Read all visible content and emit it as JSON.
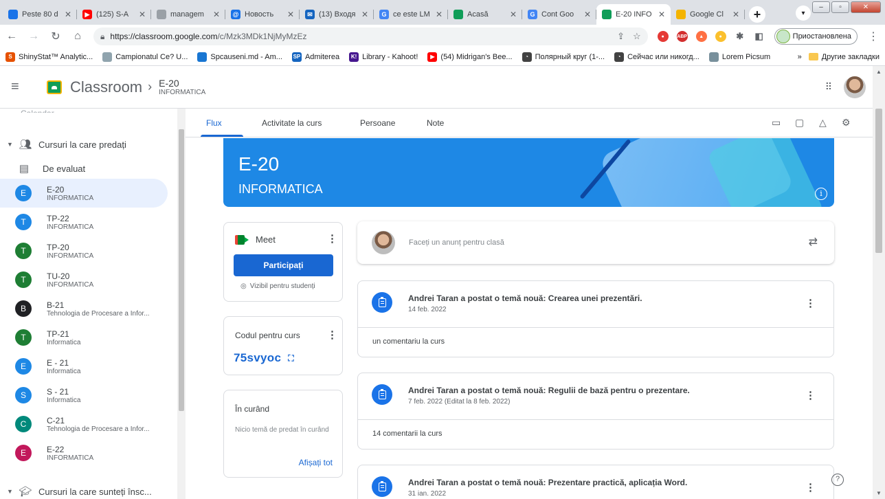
{
  "browser": {
    "tabs": [
      {
        "label": "Peste 80 d",
        "fav_color": "#1a73e8",
        "fav_char": "◉"
      },
      {
        "label": "(125) S-A",
        "fav_color": "#ff0000",
        "fav_char": "▶"
      },
      {
        "label": "managem",
        "fav_color": "#9aa0a6",
        "fav_char": "●"
      },
      {
        "label": "Новость",
        "fav_color": "#1a73e8",
        "fav_char": "@"
      },
      {
        "label": "(13) Входя",
        "fav_color": "#1565c0",
        "fav_char": "✉"
      },
      {
        "label": "ce este LM",
        "fav_color": "#4285f4",
        "fav_char": "G"
      },
      {
        "label": "Acasă",
        "fav_color": "#0f9d58",
        "fav_char": "▣"
      },
      {
        "label": "Cont Goo",
        "fav_color": "#4285f4",
        "fav_char": "G"
      },
      {
        "label": "E-20 INFO",
        "fav_color": "#0f9d58",
        "fav_char": "▣",
        "active": true
      },
      {
        "label": "Google Cl",
        "fav_color": "#f4b400",
        "fav_char": "▰"
      }
    ],
    "url_host": "https://classroom.google.com",
    "url_path": "/c/Mzk3MDk1NjMyMzEz",
    "profile_status": "Приостановлена",
    "bookmarks": [
      {
        "label": "ShinyStat™ Analytic...",
        "color": "#e65100",
        "char": "S"
      },
      {
        "label": "Campionatul Ce? U...",
        "color": "#90a4ae",
        "char": "C"
      },
      {
        "label": "Spcauseni.md - Am...",
        "color": "#1976d2",
        "char": "S"
      },
      {
        "label": "Admiterea",
        "color": "#1565c0",
        "char": "SP"
      },
      {
        "label": "Library - Kahoot!",
        "color": "#46178f",
        "char": "K!"
      },
      {
        "label": "(54) Midrigan's Bee...",
        "color": "#ff0000",
        "char": "▶"
      },
      {
        "label": "Полярный круг (1-...",
        "color": "#424242",
        "char": "◔"
      },
      {
        "label": "Сейчас или никогд...",
        "color": "#424242",
        "char": "◔"
      },
      {
        "label": "Lorem Picsum",
        "color": "#78909c",
        "char": "L"
      }
    ],
    "bookmarks_more": "»",
    "other_bookmarks": "Другие закладки"
  },
  "header": {
    "app_name": "Classroom",
    "separator": "›",
    "course_name": "E-20",
    "course_section": "INFORMATICA"
  },
  "sidebar": {
    "cut_item": "Calendar",
    "teaching_label": "Cursuri la care predați",
    "to_review_label": "De evaluat",
    "courses": [
      {
        "letter": "E",
        "name": "E-20",
        "section": "INFORMATICA",
        "color": "#1e88e5",
        "active": true
      },
      {
        "letter": "T",
        "name": "TP-22",
        "section": "INFORMATICA",
        "color": "#1e88e5"
      },
      {
        "letter": "T",
        "name": "TP-20",
        "section": "INFORMATICA",
        "color": "#1e7e34"
      },
      {
        "letter": "T",
        "name": "TU-20",
        "section": "INFORMATICA",
        "color": "#1e7e34"
      },
      {
        "letter": "B",
        "name": "B-21",
        "section": "Tehnologia de Procesare a Infor...",
        "color": "#202124"
      },
      {
        "letter": "T",
        "name": "TP-21",
        "section": "Informatica",
        "color": "#1e7e34"
      },
      {
        "letter": "E",
        "name": "E - 21",
        "section": "Informatica",
        "color": "#1e88e5"
      },
      {
        "letter": "S",
        "name": "S - 21",
        "section": "Informatica",
        "color": "#1e88e5"
      },
      {
        "letter": "C",
        "name": "C-21",
        "section": "Tehnologia de Procesare a Infor...",
        "color": "#00897b"
      },
      {
        "letter": "E",
        "name": "E-22",
        "section": "INFORMATICA",
        "color": "#c2185b"
      }
    ],
    "enrolled_label": "Cursuri la care sunteți însc..."
  },
  "main": {
    "tabs": [
      "Flux",
      "Activitate la curs",
      "Persoane",
      "Note"
    ],
    "banner_title": "E-20",
    "banner_subtitle": "INFORMATICA",
    "meet": {
      "label": "Meet",
      "join": "Participați",
      "visible": "Vizibil pentru studenți"
    },
    "class_code": {
      "title": "Codul pentru curs",
      "value": "75svyoc"
    },
    "upcoming": {
      "title": "În curând",
      "text": "Nicio temă de predat în curând",
      "view_all": "Afișați tot"
    },
    "announce_placeholder": "Faceți un anunț pentru clasă",
    "stream": [
      {
        "title": "Andrei Taran a postat o temă nouă: Crearea unei prezentări.",
        "date": "14 feb. 2022",
        "comments": "un comentariu la curs"
      },
      {
        "title": "Andrei Taran a postat o temă nouă: Regulii de bază pentru o prezentare.",
        "date": "7 feb. 2022 (Editat la 8 feb. 2022)",
        "comments": "14 comentarii la curs"
      },
      {
        "title": "Andrei Taran a postat o temă nouă: Prezentare practică, aplicația Word.",
        "date": "31 ian. 2022",
        "comments": ""
      }
    ]
  }
}
